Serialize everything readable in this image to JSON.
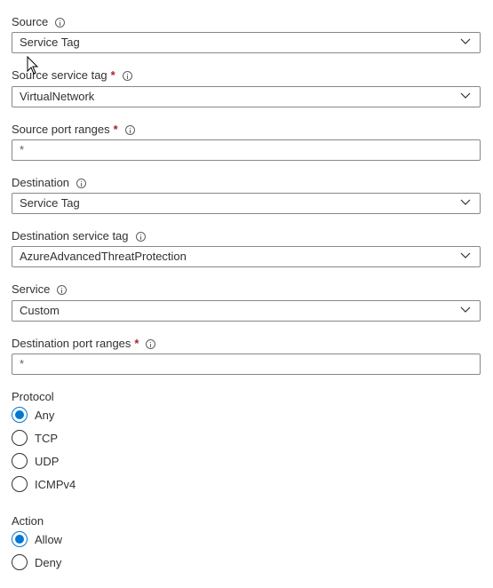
{
  "fields": {
    "source": {
      "label": "Source",
      "value": "Service Tag"
    },
    "source_service_tag": {
      "label": "Source service tag",
      "required_mark": "*",
      "value": "VirtualNetwork"
    },
    "source_port_ranges": {
      "label": "Source port ranges",
      "required_mark": "*",
      "value": "*"
    },
    "destination": {
      "label": "Destination",
      "value": "Service Tag"
    },
    "destination_service_tag": {
      "label": "Destination service tag",
      "value": "AzureAdvancedThreatProtection"
    },
    "service": {
      "label": "Service",
      "value": "Custom"
    },
    "destination_port_ranges": {
      "label": "Destination port ranges",
      "required_mark": "*",
      "value": "*"
    }
  },
  "protocol": {
    "label": "Protocol",
    "options": [
      "Any",
      "TCP",
      "UDP",
      "ICMPv4"
    ],
    "selected": "Any"
  },
  "action": {
    "label": "Action",
    "options": [
      "Allow",
      "Deny"
    ],
    "selected": "Allow"
  },
  "icons": {
    "info": "info-icon",
    "dropdown": "chevron-down-icon",
    "cursor": "mouse-pointer-icon"
  },
  "colors": {
    "accent": "#0078d4",
    "required": "#a4262c",
    "border": "#8a8886",
    "text": "#323130"
  }
}
